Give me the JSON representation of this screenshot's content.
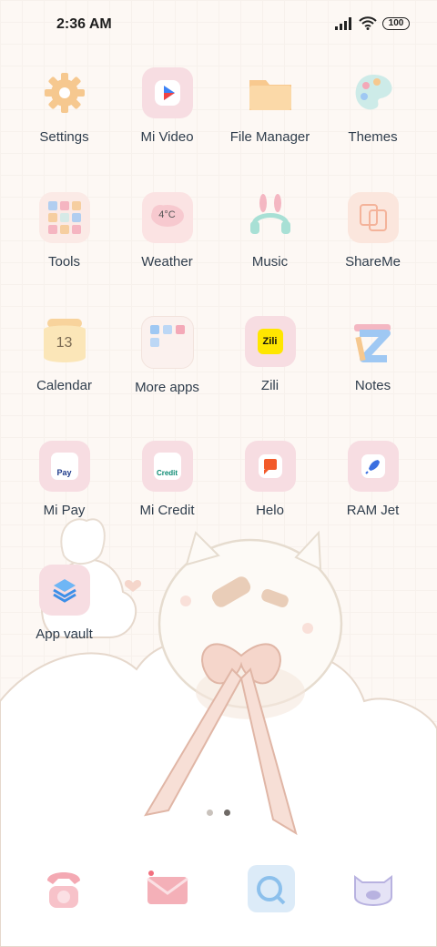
{
  "status_bar": {
    "time": "2:36 AM",
    "battery": "100",
    "icons": [
      "signal-icon",
      "wifi-icon",
      "battery-icon"
    ]
  },
  "apps": [
    {
      "label": "Settings",
      "icon": "gear-icon"
    },
    {
      "label": "Mi Video",
      "icon": "mi-video-icon"
    },
    {
      "label": "File Manager",
      "icon": "folder-icon"
    },
    {
      "label": "Themes",
      "icon": "palette-icon"
    },
    {
      "label": "Tools",
      "icon": "tools-icon"
    },
    {
      "label": "Weather",
      "icon": "weather-icon",
      "icon_text": "4°C"
    },
    {
      "label": "Music",
      "icon": "headphones-icon"
    },
    {
      "label": "ShareMe",
      "icon": "shareme-icon"
    },
    {
      "label": "Calendar",
      "icon": "calendar-icon",
      "icon_text": "13"
    },
    {
      "label": "More apps",
      "icon": "more-apps-folder-icon"
    },
    {
      "label": "Zili",
      "icon": "zili-icon",
      "icon_text": "Zili"
    },
    {
      "label": "Notes",
      "icon": "notes-icon"
    },
    {
      "label": "Mi Pay",
      "icon": "mi-pay-icon",
      "icon_text": "Pay"
    },
    {
      "label": "Mi Credit",
      "icon": "mi-credit-icon",
      "icon_text": "Credit"
    },
    {
      "label": "Helo",
      "icon": "helo-icon"
    },
    {
      "label": "RAM Jet",
      "icon": "rocket-icon"
    },
    {
      "label": "App vault",
      "icon": "app-vault-icon"
    }
  ],
  "page_indicator": {
    "count": 2,
    "active": 2
  },
  "dock": [
    {
      "name": "phone-icon"
    },
    {
      "name": "messages-icon"
    },
    {
      "name": "browser-icon"
    },
    {
      "name": "camera-icon"
    }
  ],
  "colors": {
    "background": "#fdf8f4",
    "label": "#2f3d4c",
    "icon_pink": "#f4c7cf",
    "icon_orange": "#f6c88f"
  }
}
